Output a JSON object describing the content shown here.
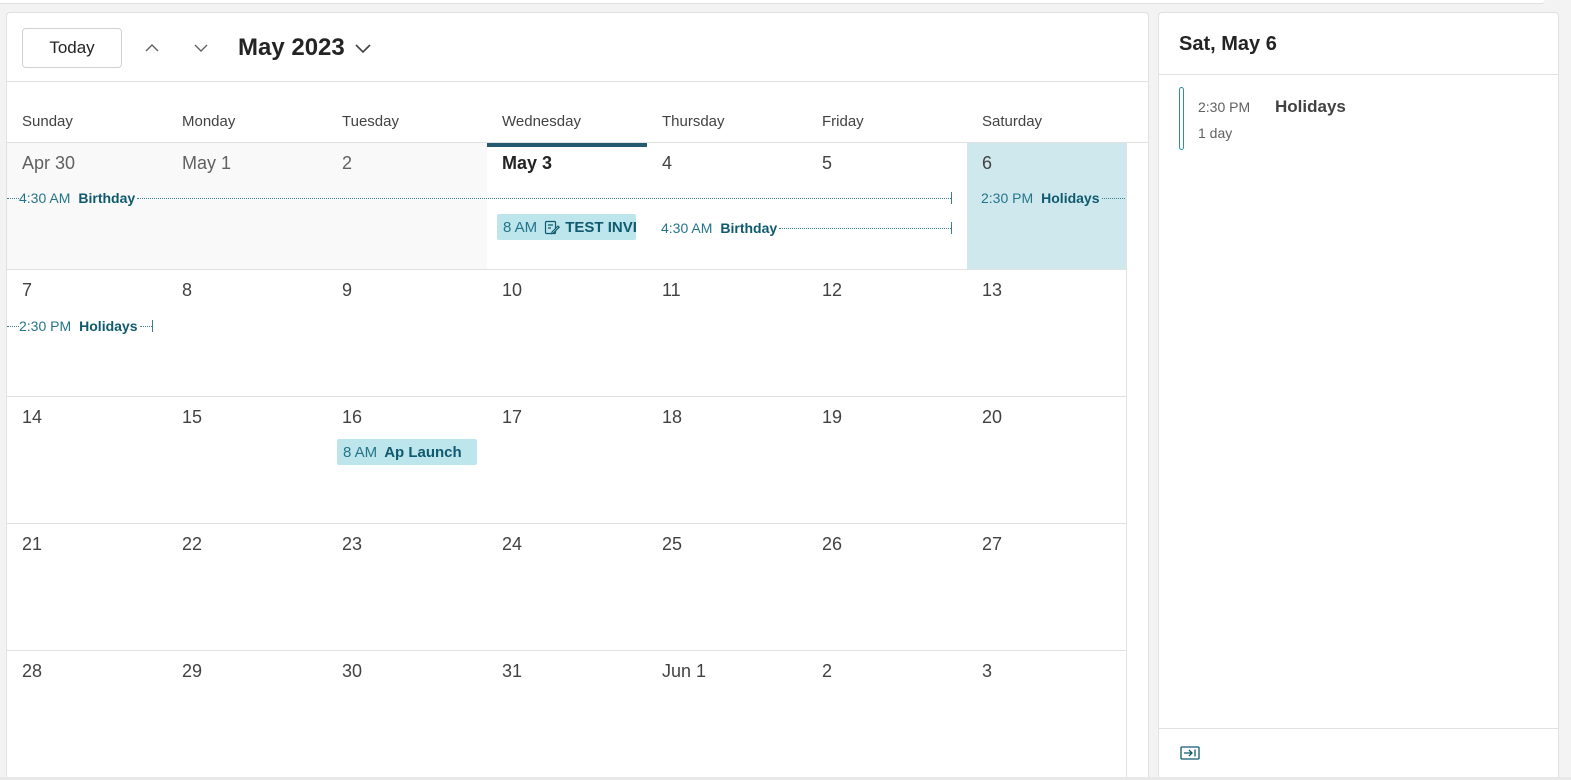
{
  "toolbar": {
    "today_label": "Today",
    "month_label": "May 2023"
  },
  "weekdays": [
    "Sunday",
    "Monday",
    "Tuesday",
    "Wednesday",
    "Thursday",
    "Friday",
    "Saturday"
  ],
  "weeks": [
    [
      "Apr 30",
      "May 1",
      "2",
      "May 3",
      "4",
      "5",
      "6"
    ],
    [
      "7",
      "8",
      "9",
      "10",
      "11",
      "12",
      "13"
    ],
    [
      "14",
      "15",
      "16",
      "17",
      "18",
      "19",
      "20"
    ],
    [
      "21",
      "22",
      "23",
      "24",
      "25",
      "26",
      "27"
    ],
    [
      "28",
      "29",
      "30",
      "31",
      "Jun 1",
      "2",
      "3"
    ]
  ],
  "events": {
    "birthday_1": {
      "time": "4:30 AM",
      "title": "Birthday"
    },
    "holidays_1": {
      "time": "2:30 PM",
      "title": "Holidays"
    },
    "test_invite": {
      "time": "8 AM",
      "title": "TEST INVI"
    },
    "birthday_2": {
      "time": "4:30 AM",
      "title": "Birthday"
    },
    "holidays_2": {
      "time": "2:30 PM",
      "title": "Holidays"
    },
    "ap_launch": {
      "time": "8 AM",
      "title": "Ap Launch"
    }
  },
  "side_pane": {
    "date_label": "Sat, May 6",
    "agenda": [
      {
        "time": "2:30 PM",
        "title": "Holidays",
        "duration": "1 day"
      }
    ]
  },
  "colors": {
    "accent": "#255a70",
    "event_fill": "#bde5ec",
    "selected_day": "#cfe8ee",
    "event_text": "#0f5a6e"
  }
}
